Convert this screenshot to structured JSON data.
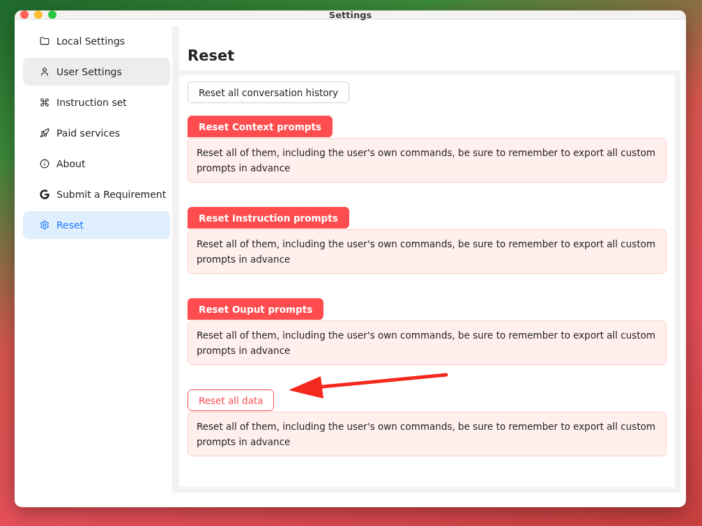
{
  "window": {
    "title": "Settings"
  },
  "sidebar": {
    "items": [
      {
        "label": "Local Settings",
        "selected": false,
        "hovered": false
      },
      {
        "label": "User Settings",
        "selected": false,
        "hovered": true
      },
      {
        "label": "Instruction set",
        "selected": false,
        "hovered": false
      },
      {
        "label": "Paid services",
        "selected": false,
        "hovered": false
      },
      {
        "label": "About",
        "selected": false,
        "hovered": false
      },
      {
        "label": "Submit a Requirement",
        "selected": false,
        "hovered": false
      },
      {
        "label": "Reset",
        "selected": true,
        "hovered": false
      }
    ]
  },
  "page": {
    "heading": "Reset",
    "sections": [
      {
        "button": {
          "label": "Reset all conversation history",
          "kind": "default"
        }
      },
      {
        "button": {
          "label": "Reset Context prompts",
          "kind": "danger"
        },
        "description": "Reset all of them, including the user's own commands, be sure to remember to export all custom prompts in advance"
      },
      {
        "button": {
          "label": "Reset Instruction prompts",
          "kind": "danger"
        },
        "description": "Reset all of them, including the user's own commands, be sure to remember to export all custom prompts in advance"
      },
      {
        "button": {
          "label": "Reset Ouput prompts",
          "kind": "danger"
        },
        "description": "Reset all of them, including the user's own commands, be sure to remember to export all custom prompts in advance"
      },
      {
        "button": {
          "label": "Reset all data",
          "kind": "danger-outline"
        },
        "description": "Reset all of them, including the user's own commands, be sure to remember to export all custom prompts in advance"
      }
    ]
  }
}
